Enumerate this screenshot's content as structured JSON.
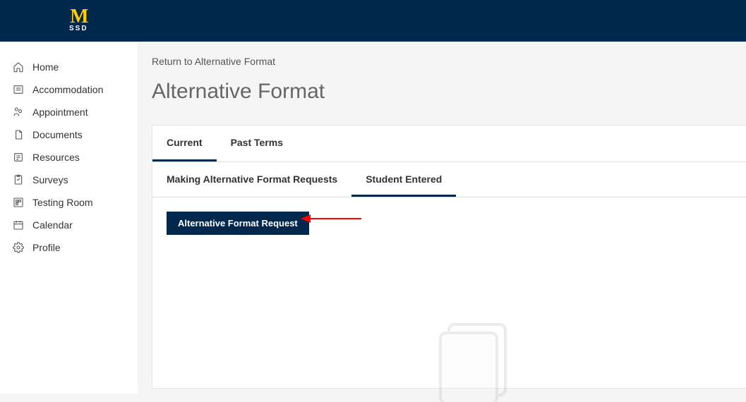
{
  "header": {
    "logo_text": "M",
    "logo_sub": "SSD"
  },
  "sidebar": {
    "items": [
      {
        "label": "Home",
        "icon": "home-icon"
      },
      {
        "label": "Accommodation",
        "icon": "accommodation-icon"
      },
      {
        "label": "Appointment",
        "icon": "appointment-icon"
      },
      {
        "label": "Documents",
        "icon": "documents-icon"
      },
      {
        "label": "Resources",
        "icon": "resources-icon"
      },
      {
        "label": "Surveys",
        "icon": "surveys-icon"
      },
      {
        "label": "Testing Room",
        "icon": "testing-room-icon"
      },
      {
        "label": "Calendar",
        "icon": "calendar-icon"
      },
      {
        "label": "Profile",
        "icon": "profile-icon"
      }
    ]
  },
  "main": {
    "breadcrumb": "Return to Alternative Format",
    "title": "Alternative Format",
    "tabs": [
      {
        "label": "Current",
        "active": true
      },
      {
        "label": "Past Terms",
        "active": false
      }
    ],
    "subtabs": [
      {
        "label": "Making Alternative Format Requests",
        "active": false
      },
      {
        "label": "Student Entered",
        "active": true
      }
    ],
    "action_button": "Alternative Format Request"
  },
  "colors": {
    "brand_bg": "#00274c",
    "brand_accent": "#ffcb05"
  }
}
